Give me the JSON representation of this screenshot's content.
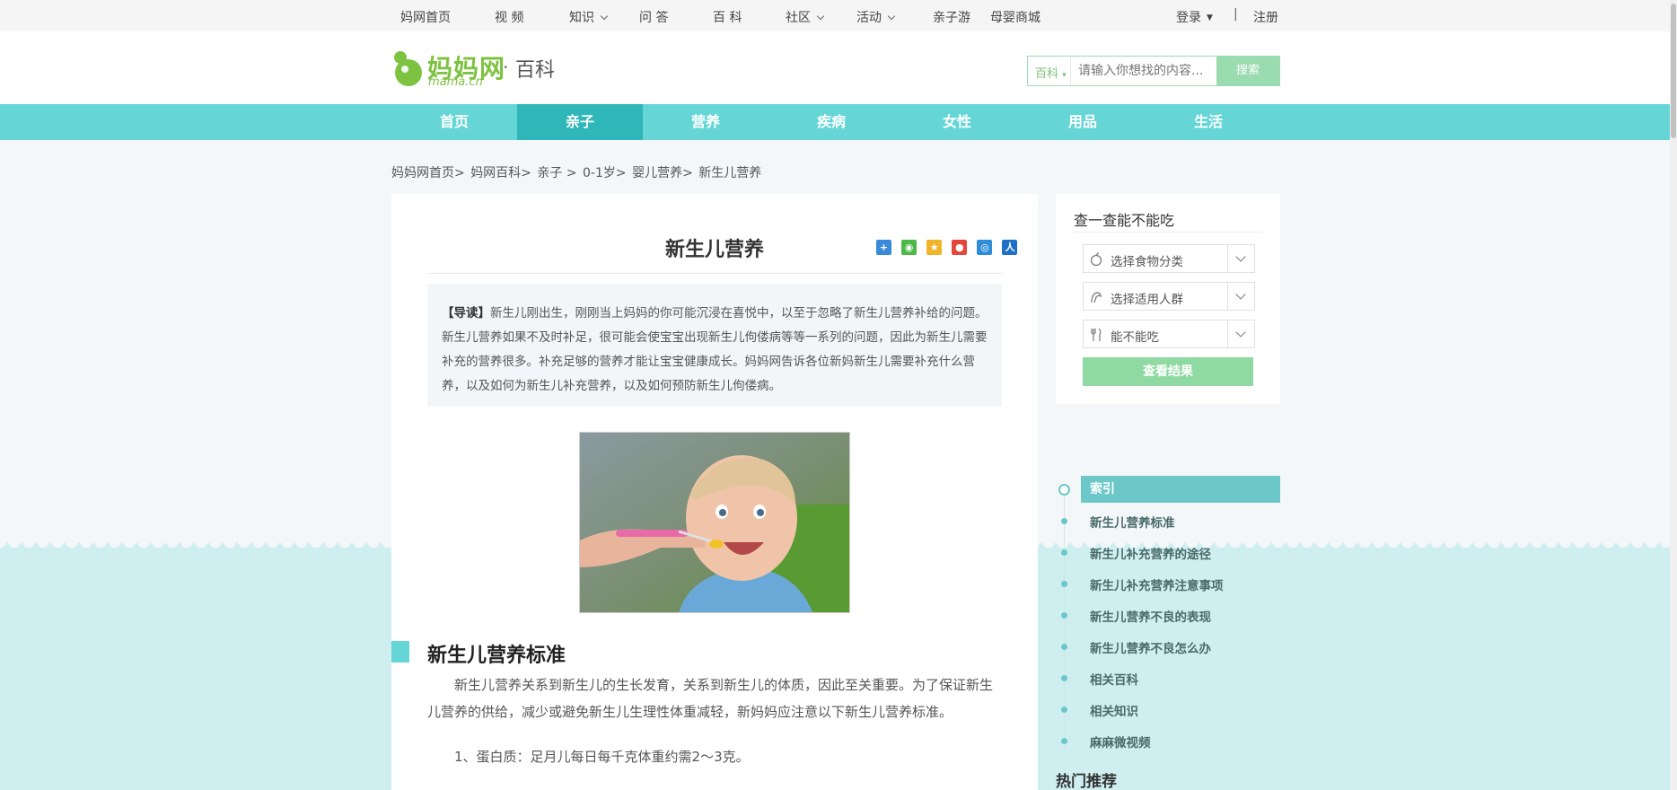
{
  "topnav": {
    "items": [
      {
        "label": "妈网首页"
      },
      {
        "label": "视 频"
      },
      {
        "label": "知识"
      },
      {
        "label": "问 答"
      },
      {
        "label": "百 科"
      },
      {
        "label": "社区"
      },
      {
        "label": "活动"
      },
      {
        "label": "亲子游"
      },
      {
        "label": "母婴商城"
      }
    ],
    "login": "登录",
    "divider": "|",
    "register": "注册"
  },
  "header": {
    "logo_text": "妈妈网",
    "logo_domain": "mama.cn",
    "logo_dot": "·",
    "section": "百科",
    "search": {
      "category": "百科",
      "placeholder": "请输入你想找的内容...",
      "button": "搜索"
    }
  },
  "mainnav": {
    "items": [
      "首页",
      "亲子",
      "营养",
      "疾病",
      "女性",
      "用品",
      "生活"
    ],
    "active": "亲子"
  },
  "breadcrumb": [
    "妈妈网首页>",
    "妈网百科>",
    "亲子 >",
    "0-1岁>",
    "婴儿营养>",
    "新生儿营养"
  ],
  "article": {
    "title": "新生儿营养",
    "intro_label": "【导读】",
    "intro_text": "新生儿刚出生，刚刚当上妈妈的你可能沉浸在喜悦中，以至于忽略了新生儿营养补给的问题。新生儿营养如果不及时补足，很可能会使宝宝出现新生儿佝偻病等等一系列的问题，因此为新生儿需要补充的营养很多。补充足够的营养才能让宝宝健康成长。妈妈网告诉各位新妈新生儿需要补充什么营养，以及如何为新生儿补充营养，以及如何预防新生儿佝偻病。",
    "section_title": "新生儿营养标准",
    "section_para": "新生儿营养关系到新生儿的生长发育，关系到新生儿的体质，因此至关重要。为了保证新生儿营养的供给，减少或避免新生儿生理性体重减轻，新妈妈应注意以下新生儿营养标准。",
    "item1": "1、蛋白质：足月儿每日每千克体重约需2～3克。"
  },
  "sidebar": {
    "title": "查一查能不能吃",
    "selects": [
      {
        "label": "选择食物分类",
        "icon": "apple-icon"
      },
      {
        "label": "选择适用人群",
        "icon": "person-icon"
      },
      {
        "label": "能不能吃",
        "icon": "fork-knife-icon"
      }
    ],
    "result_button": "查看结果"
  },
  "index": {
    "title": "索引",
    "items": [
      "新生儿营养标准",
      "新生儿补充营养的途径",
      "新生儿补充营养注意事项",
      "新生儿营养不良的表现",
      "新生儿营养不良怎么办",
      "相关百科",
      "相关知识",
      "麻麻微视频"
    ]
  },
  "hot_title": "热门推荐",
  "colors": {
    "nav": "#65d5d6",
    "nav_active": "#2eb6b8",
    "brand_green": "#7ec242",
    "button_green": "#8fd9a2"
  }
}
